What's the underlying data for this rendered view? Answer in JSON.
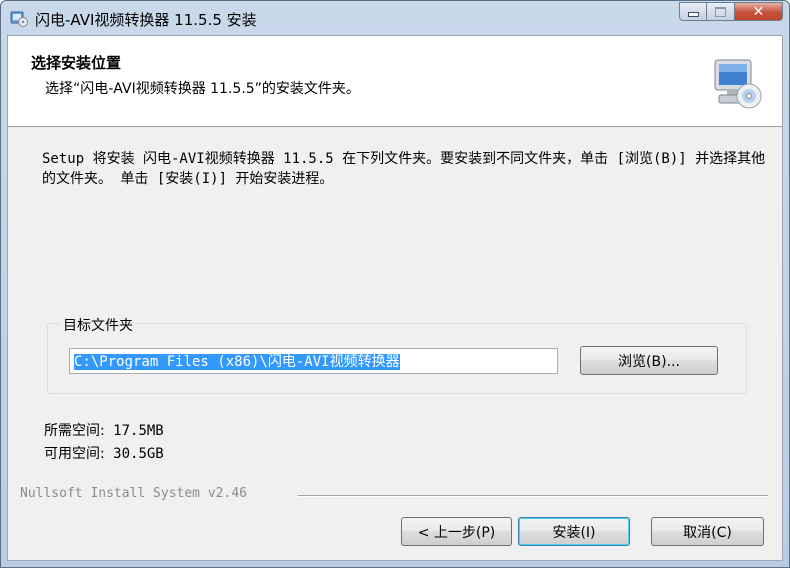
{
  "window": {
    "title": "闪电-AVI视频转换器 11.5.5 安装",
    "app_icon": "installer-icon",
    "caption_buttons": [
      "minimize-icon",
      "maximize-icon",
      "close-icon"
    ]
  },
  "header": {
    "title": "选择安装位置",
    "subtitle": "选择“闪电-AVI视频转换器 11.5.5”的安装文件夹。",
    "icon": "computer-cd-icon"
  },
  "description": "Setup 将安装 闪电-AVI视频转换器 11.5.5 在下列文件夹。要安装到不同文件夹，单击 [浏览(B)] 并选择其他的文件夹。 单击 [安装(I)] 开始安装进程。",
  "destination": {
    "group_label": "目标文件夹",
    "path_value": "C:\\Program Files (x86)\\闪电-AVI视频转换器",
    "browse_label": "浏览(B)..."
  },
  "space": {
    "required_label": "所需空间:",
    "required_value": "17.5MB",
    "available_label": "可用空间:",
    "available_value": "30.5GB"
  },
  "branding": "Nullsoft Install System v2.46",
  "buttons": {
    "back": "< 上一步(P)",
    "install": "安装(I)",
    "cancel": "取消(C)"
  },
  "colors": {
    "selection": "#3399ff",
    "dialog_bg": "#f0f0f0",
    "close_button": "#c6513a",
    "title_bar": "#c9d9ea"
  }
}
